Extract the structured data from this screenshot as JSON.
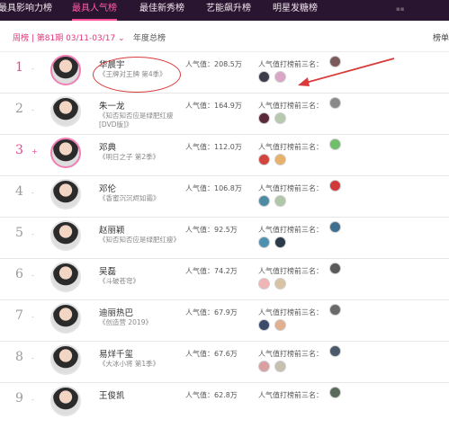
{
  "nav": {
    "items": [
      {
        "label": "最具影响力榜",
        "active": false
      },
      {
        "label": "最具人气榜",
        "active": true
      },
      {
        "label": "最佳新秀榜",
        "active": false
      },
      {
        "label": "艺能飙升榜",
        "active": false
      },
      {
        "label": "明星发糖榜",
        "active": false
      }
    ]
  },
  "filter": {
    "week": "周榜 | 第81期 03/11-03/17",
    "year": "年度总榜",
    "list_btn": "榜单"
  },
  "rows": [
    {
      "rank": "1",
      "trend": "-",
      "name": "华晨宇",
      "work": "《王牌对王牌 第4季》",
      "pop": "人气值：208.5万",
      "fans_label": "人气值打榜前三名：",
      "fan_colors": [
        "#7a5a5a",
        "#3b3b4a",
        "#d9a6c6"
      ]
    },
    {
      "rank": "2",
      "trend": "-",
      "name": "朱一龙",
      "work": "《知否知否应是绿肥红瘦[DVD版]》",
      "pop": "人气值：164.9万",
      "fans_label": "人气值打榜前三名：",
      "fan_colors": [
        "#8a8a8a",
        "#5a2a3a",
        "#b7c9b0"
      ]
    },
    {
      "rank": "3",
      "trend": "+",
      "name": "邓典",
      "work": "《明日之子 第2季》",
      "pop": "人气值：112.0万",
      "fans_label": "人气值打榜前三名：",
      "fan_colors": [
        "#6fbf6a",
        "#d2453f",
        "#e8b26b"
      ]
    },
    {
      "rank": "4",
      "trend": "-",
      "name": "邓伦",
      "work": "《香蜜沉沉烬如霜》",
      "pop": "人气值：106.8万",
      "fans_label": "人气值打榜前三名：",
      "fan_colors": [
        "#d13a3a",
        "#4d8aa3",
        "#b0c7a8"
      ]
    },
    {
      "rank": "5",
      "trend": "-",
      "name": "赵丽颖",
      "work": "《知否知否应是绿肥红瘦》",
      "pop": "人气值：92.5万",
      "fans_label": "人气值打榜前三名：",
      "fan_colors": [
        "#3f6f8f",
        "#4f8fb0",
        "#2b3a4a"
      ]
    },
    {
      "rank": "6",
      "trend": "-",
      "name": "吴磊",
      "work": "《斗破苍穹》",
      "pop": "人气值：74.2万",
      "fans_label": "人气值打榜前三名：",
      "fan_colors": [
        "#5a5a5a",
        "#f0b5b5",
        "#d8c3a5"
      ]
    },
    {
      "rank": "7",
      "trend": "-",
      "name": "迪丽热巴",
      "work": "《创造营 2019》",
      "pop": "人气值：67.9万",
      "fans_label": "人气值打榜前三名：",
      "fan_colors": [
        "#6a6a6a",
        "#3a4a6a",
        "#e0b090"
      ]
    },
    {
      "rank": "8",
      "trend": "-",
      "name": "易烊千玺",
      "work": "《大冰小将 第1季》",
      "pop": "人气值：67.6万",
      "fans_label": "人气值打榜前三名：",
      "fan_colors": [
        "#4a5a6a",
        "#d8a0a0",
        "#c7c0b0"
      ]
    },
    {
      "rank": "9",
      "trend": "-",
      "name": "王俊凯",
      "work": "",
      "pop": "人气值：62.8万",
      "fans_label": "人气值打榜前三名：",
      "fan_colors": [
        "#5a6a5a",
        "#a0a0c0",
        "#c0a080"
      ]
    }
  ]
}
